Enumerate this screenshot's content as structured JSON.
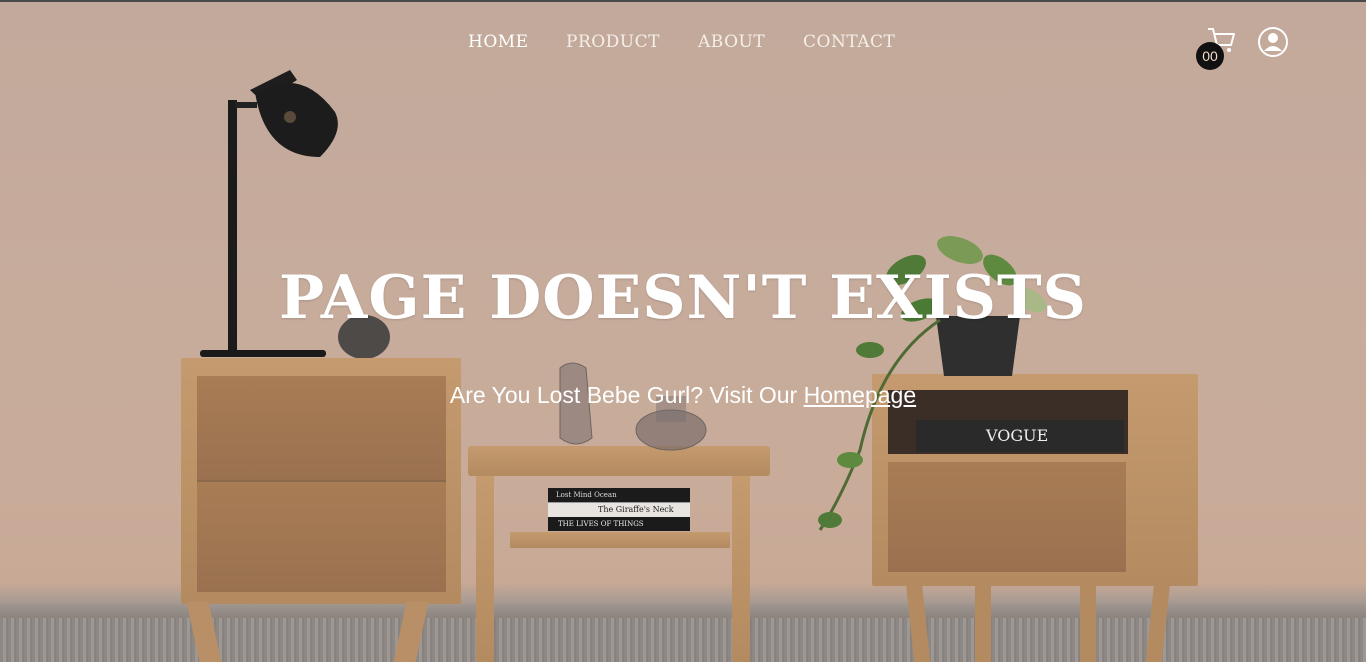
{
  "nav": {
    "items": [
      {
        "id": "home",
        "label": "HOME",
        "active": true
      },
      {
        "id": "product",
        "label": "PRODUCT",
        "active": false
      },
      {
        "id": "about",
        "label": "ABOUT",
        "active": false
      },
      {
        "id": "contact",
        "label": "CONTACT",
        "active": false
      }
    ]
  },
  "cart": {
    "count": "00",
    "icon": "cart-icon"
  },
  "user": {
    "icon": "user-circle-icon"
  },
  "hero": {
    "headline": "PAGE DOESN'T EXISTS",
    "subtitle_prefix": "Are You Lost Bebe Gurl? Visit Our ",
    "subtitle_link": "Homepage"
  },
  "scene": {
    "books_left": [
      "Lost Mind Ocean",
      "The Giraffe's Neck",
      "THE LIVES OF THINGS"
    ],
    "magazine": "VOGUE"
  },
  "colors": {
    "wall": "#c4aa9b",
    "text": "#ffffff",
    "badge": "#111111"
  }
}
